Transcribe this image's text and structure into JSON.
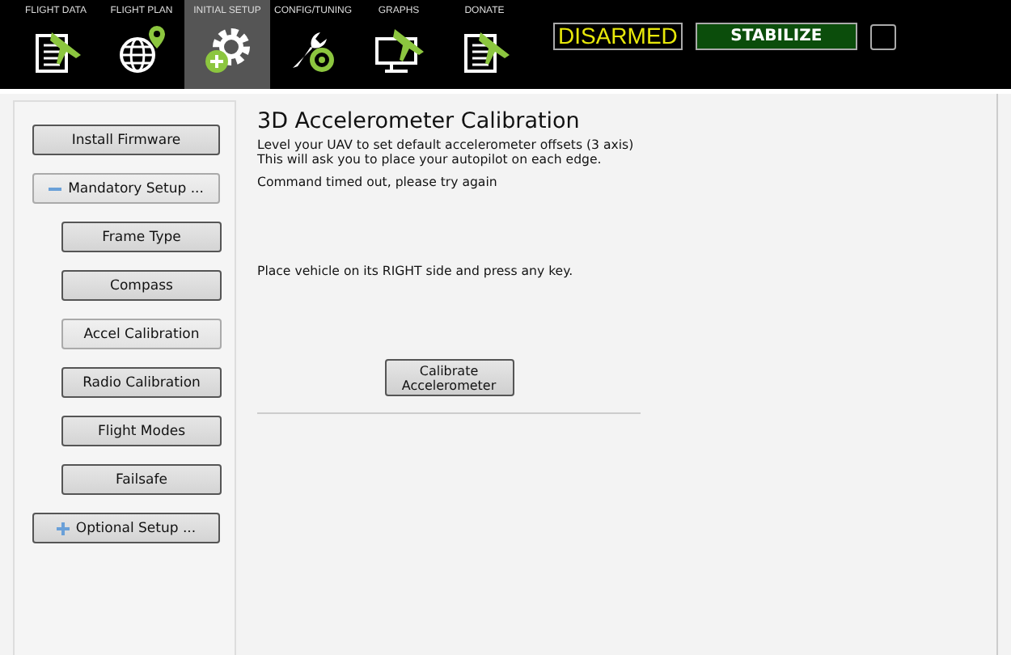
{
  "toolbar": {
    "tabs": [
      {
        "label": "FLIGHT DATA",
        "kind": "document-plane",
        "selected": false
      },
      {
        "label": "FLIGHT PLAN",
        "kind": "globe-pin",
        "selected": false
      },
      {
        "label": "INITIAL SETUP",
        "kind": "gear-plus",
        "selected": true
      },
      {
        "label": "CONFIG/TUNING",
        "kind": "wrench-gear",
        "selected": false
      },
      {
        "label": "GRAPHS",
        "kind": "monitor-plane",
        "selected": false
      },
      {
        "label": "DONATE",
        "kind": "document-plane",
        "selected": false
      }
    ],
    "arm_status": "DISARMED",
    "flight_mode": "STABILIZE"
  },
  "sidebar": {
    "items": [
      {
        "kind": "button",
        "label": "Install Firmware",
        "selected": false
      },
      {
        "kind": "section",
        "label": "Mandatory Setup ...",
        "expanded": true,
        "children": [
          {
            "label": "Frame Type",
            "selected": false
          },
          {
            "label": "Compass",
            "selected": false
          },
          {
            "label": "Accel Calibration",
            "selected": true
          },
          {
            "label": "Radio Calibration",
            "selected": false
          },
          {
            "label": "Flight Modes",
            "selected": false
          },
          {
            "label": "Failsafe",
            "selected": false
          }
        ]
      },
      {
        "kind": "section",
        "label": "Optional Setup ...",
        "expanded": false
      }
    ]
  },
  "panel": {
    "title": "3D Accelerometer Calibration",
    "description": [
      "Level your UAV to set default accelerometer offsets (3 axis)",
      "This will ask you to place your autopilot on each edge."
    ],
    "status": "Command timed out, please try again",
    "instruction": "Place vehicle on its RIGHT side and press any key.",
    "button": "Calibrate Accelerometer"
  }
}
